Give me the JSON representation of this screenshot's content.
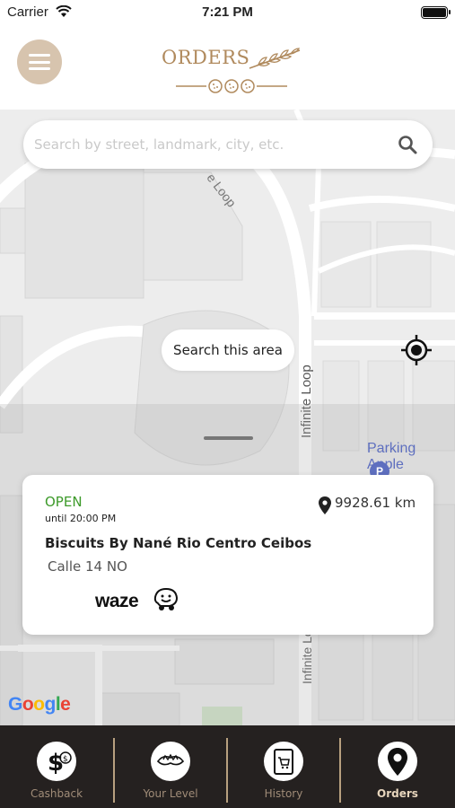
{
  "status_bar": {
    "carrier": "Carrier",
    "time": "7:21 PM"
  },
  "header": {
    "logo_text": "ORDERS",
    "menu_icon": "hamburger-menu-icon",
    "brand_color": "#b08a5d",
    "menu_bg_color": "#d7c4ae"
  },
  "search": {
    "placeholder": "Search by street, landmark, city, etc.",
    "value": ""
  },
  "map": {
    "search_area_label": "Search this area",
    "street_labels": [
      "Infinite Loop",
      "Infinite Loop",
      "e Loop"
    ],
    "poi": {
      "name": "Parking Apple",
      "marker": "P"
    },
    "attribution": "Google"
  },
  "store_card": {
    "status": "OPEN",
    "status_color": "#3d9a2a",
    "hours": "until 20:00 PM",
    "distance": "9928.61 km",
    "name": "Biscuits By Nané Rio Centro Ceibos",
    "address": "Calle 14 NO",
    "nav_app": "waze"
  },
  "tabs": [
    {
      "label": "Cashback",
      "icon": "cashback-dollar-icon",
      "active": false
    },
    {
      "label": "Your Level",
      "icon": "crown-level-icon",
      "active": false
    },
    {
      "label": "History",
      "icon": "tablet-cart-icon",
      "active": false
    },
    {
      "label": "Orders",
      "icon": "location-pin-icon",
      "active": true
    }
  ],
  "colors": {
    "tab_bar_bg": "#252120",
    "tab_label": "#a08c78",
    "tab_label_active": "#e8d6bd",
    "divider": "#b7a07f"
  }
}
